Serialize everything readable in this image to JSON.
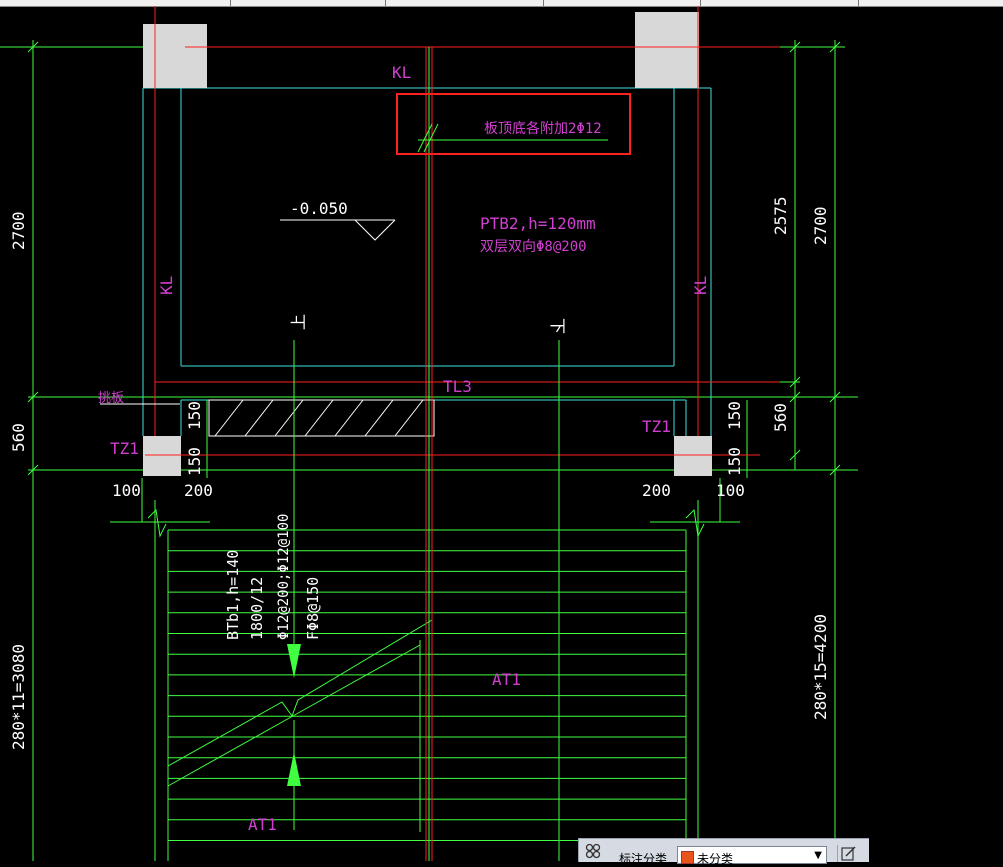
{
  "labels": {
    "kl_top": "KL",
    "kl_left": "KL",
    "kl_right": "KL",
    "note_red_box": "板顶底各附加2Φ12",
    "elevation": "-0.050",
    "ptb2_line1": "PTB2,h=120mm",
    "ptb2_line2": "双层双向Φ8@200",
    "up": "上",
    "down": "下",
    "tl3": "TL3",
    "tiaoban": "挑板",
    "tz1_left": "TZ1",
    "tz1_right": "TZ1",
    "btb1_line1": "BTb1,h=140",
    "btb1_line2": "1800/12",
    "btb1_line3": "Φ12@200;Φ12@100",
    "btb1_line4": "FΦ8@150",
    "at1_right": "AT1",
    "at1_left": "AT1"
  },
  "dimensions": {
    "left_top": "2700",
    "left_mid": "560",
    "left_bottom": "280*11=3080",
    "right_a": "2575",
    "right_b": "2700",
    "right_mid": "560",
    "right_bottom": "280*15=4200",
    "d150_l1": "150",
    "d150_l2": "150",
    "d150_r1": "150",
    "d150_r2": "150",
    "d100_l": "100",
    "d200_l": "200",
    "d200_r": "200",
    "d100_r": "100"
  },
  "panel": {
    "label": "标注分类",
    "selected": "未分类",
    "swatch_color": "#e8541c"
  },
  "colors": {
    "background": "#000000",
    "red": "#ff2020",
    "green": "#40ff40",
    "cyan": "#40e0e0",
    "magenta": "#d040d0",
    "white": "#ffffff",
    "gray_fill": "#d8d8d8"
  }
}
